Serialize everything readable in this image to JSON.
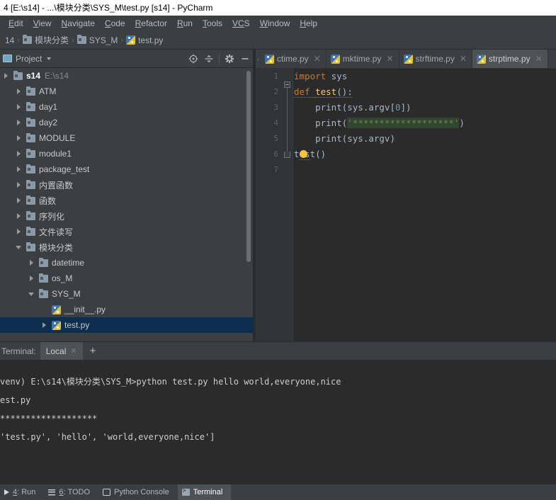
{
  "window": {
    "title": "4 [E:\\s14] - ...\\模块分类\\SYS_M\\test.py [s14] - PyCharm"
  },
  "menubar": {
    "items": [
      {
        "label": "Edit",
        "mnemonic": "E",
        "rest": "dit"
      },
      {
        "label": "View",
        "mnemonic": "V",
        "rest": "iew"
      },
      {
        "label": "Navigate",
        "mnemonic": "N",
        "rest": "avigate"
      },
      {
        "label": "Code",
        "mnemonic": "C",
        "rest": "ode"
      },
      {
        "label": "Refactor",
        "mnemonic": "R",
        "rest": "efactor"
      },
      {
        "label": "Run",
        "mnemonic": "R",
        "rest": "un"
      },
      {
        "label": "Tools",
        "mnemonic": "T",
        "rest": "ools"
      },
      {
        "label": "VCS",
        "mnemonic": "VC",
        "rest": "S"
      },
      {
        "label": "Window",
        "mnemonic": "W",
        "rest": "indow"
      },
      {
        "label": "Help",
        "mnemonic": "H",
        "rest": "elp"
      }
    ]
  },
  "breadcrumb": {
    "items": [
      {
        "label": "14",
        "icon": "none"
      },
      {
        "label": "模块分类",
        "icon": "folder-icon"
      },
      {
        "label": "SYS_M",
        "icon": "folder-icon"
      },
      {
        "label": "test.py",
        "icon": "python-file-icon"
      }
    ],
    "separator": "›"
  },
  "project_panel": {
    "title": "Project",
    "tools": [
      {
        "name": "locate-target-icon",
        "glyph": "⊕"
      },
      {
        "name": "collapse-all-icon",
        "glyph": "⇳"
      },
      {
        "name": "settings-gear-icon",
        "glyph": "✻"
      },
      {
        "name": "hide-panel-icon",
        "glyph": "—"
      }
    ],
    "tree": [
      {
        "label": "s14",
        "sublabel": "E:\\s14",
        "icon": "folder-icon",
        "arrow": "right",
        "indent": 0,
        "bold": true,
        "selected": false
      },
      {
        "label": "ATM",
        "sublabel": "",
        "icon": "folder-icon",
        "arrow": "right",
        "indent": 1,
        "bold": false,
        "selected": false
      },
      {
        "label": "day1",
        "sublabel": "",
        "icon": "folder-icon",
        "arrow": "right",
        "indent": 1,
        "bold": false,
        "selected": false
      },
      {
        "label": "day2",
        "sublabel": "",
        "icon": "folder-icon",
        "arrow": "right",
        "indent": 1,
        "bold": false,
        "selected": false
      },
      {
        "label": "MODULE",
        "sublabel": "",
        "icon": "folder-icon",
        "arrow": "right",
        "indent": 1,
        "bold": false,
        "selected": false
      },
      {
        "label": "module1",
        "sublabel": "",
        "icon": "folder-icon",
        "arrow": "right",
        "indent": 1,
        "bold": false,
        "selected": false
      },
      {
        "label": "package_test",
        "sublabel": "",
        "icon": "folder-icon",
        "arrow": "right",
        "indent": 1,
        "bold": false,
        "selected": false
      },
      {
        "label": "内置函数",
        "sublabel": "",
        "icon": "folder-icon",
        "arrow": "right",
        "indent": 1,
        "bold": false,
        "selected": false
      },
      {
        "label": "函数",
        "sublabel": "",
        "icon": "folder-icon",
        "arrow": "right",
        "indent": 1,
        "bold": false,
        "selected": false
      },
      {
        "label": "序列化",
        "sublabel": "",
        "icon": "folder-icon",
        "arrow": "right",
        "indent": 1,
        "bold": false,
        "selected": false
      },
      {
        "label": "文件读写",
        "sublabel": "",
        "icon": "folder-icon",
        "arrow": "right",
        "indent": 1,
        "bold": false,
        "selected": false
      },
      {
        "label": "模块分类",
        "sublabel": "",
        "icon": "folder-icon",
        "arrow": "down",
        "indent": 1,
        "bold": false,
        "selected": false
      },
      {
        "label": "datetime",
        "sublabel": "",
        "icon": "folder-icon",
        "arrow": "right",
        "indent": 2,
        "bold": false,
        "selected": false
      },
      {
        "label": "os_M",
        "sublabel": "",
        "icon": "folder-icon",
        "arrow": "right",
        "indent": 2,
        "bold": false,
        "selected": false
      },
      {
        "label": "SYS_M",
        "sublabel": "",
        "icon": "folder-icon",
        "arrow": "down",
        "indent": 2,
        "bold": false,
        "selected": false
      },
      {
        "label": "__init__.py",
        "sublabel": "",
        "icon": "python-file-icon",
        "arrow": "none",
        "indent": 3,
        "bold": false,
        "selected": false
      },
      {
        "label": "test.py",
        "sublabel": "",
        "icon": "python-file-icon",
        "arrow": "right",
        "indent": 3,
        "bold": false,
        "selected": true
      }
    ]
  },
  "editor": {
    "tabs": [
      {
        "label": "ctime.py",
        "active": false,
        "icon": "python-file-icon"
      },
      {
        "label": "mktime.py",
        "active": false,
        "icon": "python-file-icon"
      },
      {
        "label": "strftime.py",
        "active": false,
        "icon": "python-file-icon"
      },
      {
        "label": "strptime.py",
        "active": true,
        "icon": "python-file-icon"
      }
    ],
    "close_glyph": "✕",
    "line_numbers": [
      "1",
      "2",
      "3",
      "4",
      "5",
      "6",
      "7"
    ],
    "lines": [
      {
        "n": "1",
        "tokens": [
          {
            "t": "import",
            "c": "kw"
          },
          {
            "t": " sys",
            "c": "pl"
          }
        ]
      },
      {
        "n": "2",
        "tokens": [
          {
            "t": "def",
            "c": "kw"
          },
          {
            "t": " ",
            "c": "pl"
          },
          {
            "t": "test",
            "c": "fn"
          },
          {
            "t": "():",
            "c": "pl"
          }
        ]
      },
      {
        "n": "3",
        "tokens": [
          {
            "t": "    print(sys.argv[",
            "c": "pl"
          },
          {
            "t": "0",
            "c": "num"
          },
          {
            "t": "])",
            "c": "pl"
          }
        ]
      },
      {
        "n": "4",
        "tokens": [
          {
            "t": "    print(",
            "c": "pl"
          },
          {
            "t": "'*******************'",
            "c": "str"
          },
          {
            "t": ")",
            "c": "pl"
          }
        ]
      },
      {
        "n": "5",
        "tokens": [
          {
            "t": "    print(sys.argv)",
            "c": "pl"
          }
        ]
      },
      {
        "n": "6",
        "tokens": [
          {
            "t": "test()",
            "c": "pl"
          }
        ]
      },
      {
        "n": "7",
        "tokens": [
          {
            "t": "",
            "c": "pl"
          }
        ]
      }
    ]
  },
  "terminal_panel": {
    "label": "Terminal:",
    "tab_label": "Local",
    "tab_close": "✕",
    "add_label": "+",
    "lines": [
      "venv) E:\\s14\\模块分类\\SYS_M>python test.py hello world,everyone,nice",
      "est.py",
      "*******************",
      "'test.py', 'hello', 'world,everyone,nice']"
    ]
  },
  "statusbar": {
    "items": [
      {
        "label": "4: Run",
        "mnemonic": "4",
        "rest": ": Run",
        "icon": "run-icon",
        "active": false
      },
      {
        "label": "6: TODO",
        "mnemonic": "6",
        "rest": ": TODO",
        "icon": "todo-icon",
        "active": false
      },
      {
        "label": "Python Console",
        "mnemonic": "",
        "rest": "Python Console",
        "icon": "console-icon",
        "active": false
      },
      {
        "label": "Terminal",
        "mnemonic": "",
        "rest": "Terminal",
        "icon": "terminal-icon",
        "active": true
      }
    ]
  },
  "colors": {
    "chrome": "#3c3f41",
    "editor_bg": "#2b2b2b",
    "selection": "#0d2e4e",
    "accent_keyword": "#cc7832",
    "accent_function": "#ffc66d",
    "accent_string": "#6a8759",
    "accent_number": "#6897bb",
    "text": "#a9b7c6"
  }
}
